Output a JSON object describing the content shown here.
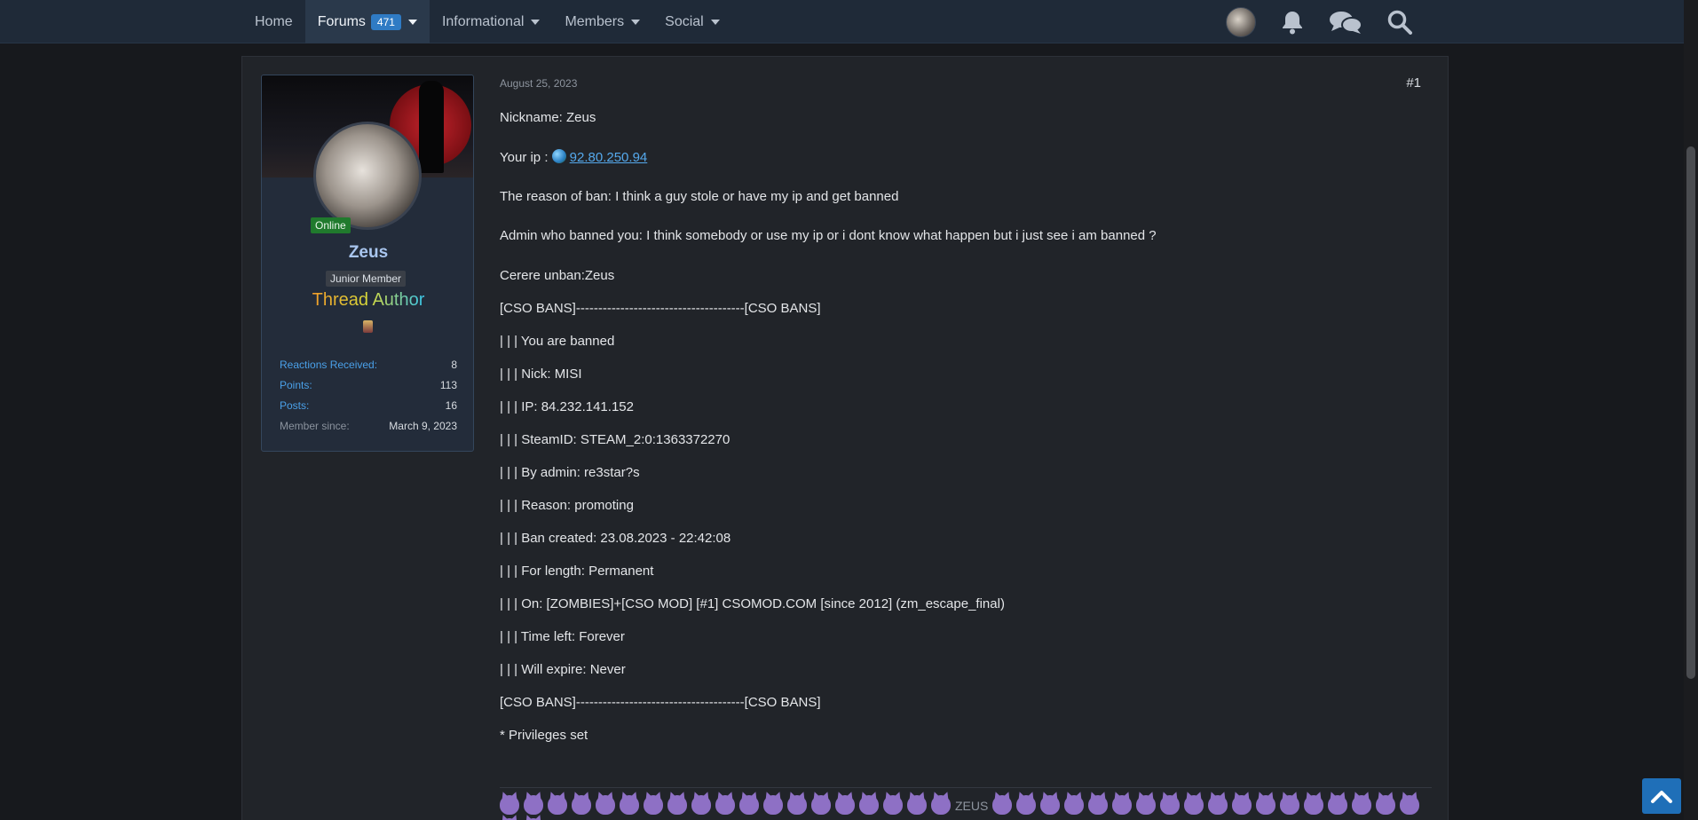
{
  "nav": {
    "tabs": [
      {
        "label": "Home"
      },
      {
        "label": "Forums",
        "count": "471"
      },
      {
        "label": "Informational"
      },
      {
        "label": "Members"
      },
      {
        "label": "Social"
      }
    ]
  },
  "user": {
    "online": "Online",
    "name": "Zeus",
    "title": "Junior Member",
    "badge": "Thread Author",
    "stats": [
      {
        "label": "Reactions Received:",
        "value": "8"
      },
      {
        "label": "Points:",
        "value": "113"
      },
      {
        "label": "Posts:",
        "value": "16"
      },
      {
        "label": "Member since:",
        "value": "March 9, 2023"
      }
    ]
  },
  "post": {
    "date": "August 25, 2023",
    "number": "#1",
    "nickname": "Nickname: Zeus",
    "ip_label": "Your ip :",
    "ip": "92.80.250.94",
    "reason": "The reason of ban: I think a guy stole or have my ip and get banned",
    "admin": "Admin who banned you: I think somebody or use my ip or i dont know what happen but i just see i am banned ?",
    "request": "Cerere unban:Zeus",
    "ban_lines": [
      "[CSO BANS]--------------------------------------[CSO BANS]",
      "| | | You are banned",
      "| | | Nick: MISI",
      "| | | IP: 84.232.141.152",
      "| | | SteamID: STEAM_2:0:1363372270",
      "| | | By admin: re3star?s",
      "| | | Reason: promoting",
      "| | | Ban created: 23.08.2023 - 22:42:08",
      "| | | For length: Permanent",
      "| | | On: [ZOMBIES]+[CSO MOD] [#1] CSOMOD.COM [since 2012] (zm_escape_final)",
      "| | | Time left: Forever",
      "| | | Will expire: Never",
      "[CSO BANS]--------------------------------------[CSO BANS]",
      "* Privileges set"
    ],
    "signature_text": "ZEUS"
  },
  "icons": {
    "notifications": "bell-icon",
    "conversations": "chat-bubbles-icon",
    "search": "search-icon",
    "scroll_top": "chevron-up-icon"
  },
  "colors": {
    "accent": "#2f7bc4",
    "link": "#55a9ec",
    "online": "#207a2d",
    "username": "#a9c6ef"
  }
}
